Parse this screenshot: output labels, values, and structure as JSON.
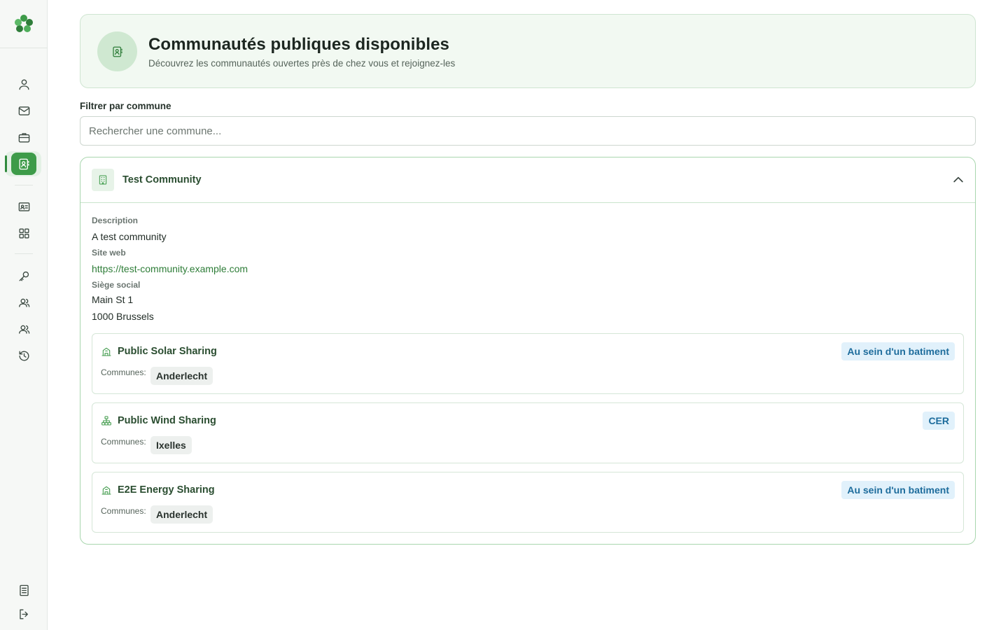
{
  "sidebar": {
    "items": [
      {
        "name": "profile",
        "icon": "user-icon"
      },
      {
        "name": "messages",
        "icon": "mail-icon"
      },
      {
        "name": "portfolio",
        "icon": "briefcase-icon"
      },
      {
        "name": "communities",
        "icon": "contact-book-icon",
        "active": true
      },
      {
        "name": "id-card",
        "icon": "id-card-icon"
      },
      {
        "name": "dashboard",
        "icon": "grid-icon"
      },
      {
        "name": "keys",
        "icon": "key-icon"
      },
      {
        "name": "members",
        "icon": "users-icon"
      },
      {
        "name": "members-2",
        "icon": "users-icon"
      },
      {
        "name": "history",
        "icon": "history-icon"
      },
      {
        "name": "documents",
        "icon": "document-icon"
      },
      {
        "name": "logout",
        "icon": "logout-icon"
      }
    ],
    "accent": "#3d9b49"
  },
  "header": {
    "title": "Communautés publiques disponibles",
    "subtitle": "Découvrez les communautés ouvertes près de chez vous et rejoignez-les"
  },
  "filter": {
    "label": "Filtrer par commune",
    "placeholder": "Rechercher une commune...",
    "value": ""
  },
  "community": {
    "name": "Test Community",
    "description_label": "Description",
    "description": "A test community",
    "website_label": "Site web",
    "website": "https://test-community.example.com",
    "address_label": "Siège social",
    "address_line1": "Main St 1",
    "address_line2": "1000 Brussels",
    "sharings": [
      {
        "name": "Public Solar Sharing",
        "icon": "building-icon",
        "type": "Au sein d'un batiment",
        "communes_label": "Communes:",
        "communes": [
          "Anderlecht"
        ]
      },
      {
        "name": "Public Wind Sharing",
        "icon": "network-icon",
        "type": "CER",
        "communes_label": "Communes:",
        "communes": [
          "Ixelles"
        ]
      },
      {
        "name": "E2E Energy Sharing",
        "icon": "building-icon",
        "type": "Au sein d'un batiment",
        "communes_label": "Communes:",
        "communes": [
          "Anderlecht"
        ]
      }
    ]
  },
  "colors": {
    "primary": "#3d9b49",
    "card_border": "#a9d6ae",
    "badge_bg": "#e1f1fb",
    "badge_text": "#1d6c9c"
  }
}
